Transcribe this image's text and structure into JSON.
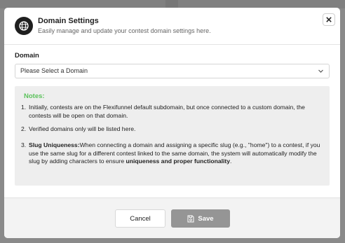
{
  "modal": {
    "title": "Domain Settings",
    "subtitle": "Easily manage and update your contest domain settings here.",
    "icon": "globe-icon",
    "close_icon": "close-icon"
  },
  "domain_field": {
    "label": "Domain",
    "selected_value": "Please Select a Domain",
    "chevron_icon": "chevron-down-icon"
  },
  "notes": {
    "title": "Notes:",
    "title_color": "#5cc25c",
    "items": [
      {
        "number": "1.",
        "text": "Initially, contests are on the Flexifunnel default subdomain, but once connected to a custom domain, the contests will be open on that domain."
      },
      {
        "number": "2.",
        "text": "Verified domains only will be listed here."
      },
      {
        "number": "3.",
        "heading": "Slug Uniqueness:",
        "text": "When connecting a domain and assigning a specific slug (e.g., \"home\") to a contest, if you use the same slug for a different contest linked to the same domain, the system will automatically modify the slug by adding characters to ensure ",
        "emphasis": "uniqueness and proper functionality",
        "end": "."
      }
    ]
  },
  "footer": {
    "cancel_label": "Cancel",
    "save_label": "Save",
    "save_icon": "save-icon",
    "save_color": "#959595"
  }
}
